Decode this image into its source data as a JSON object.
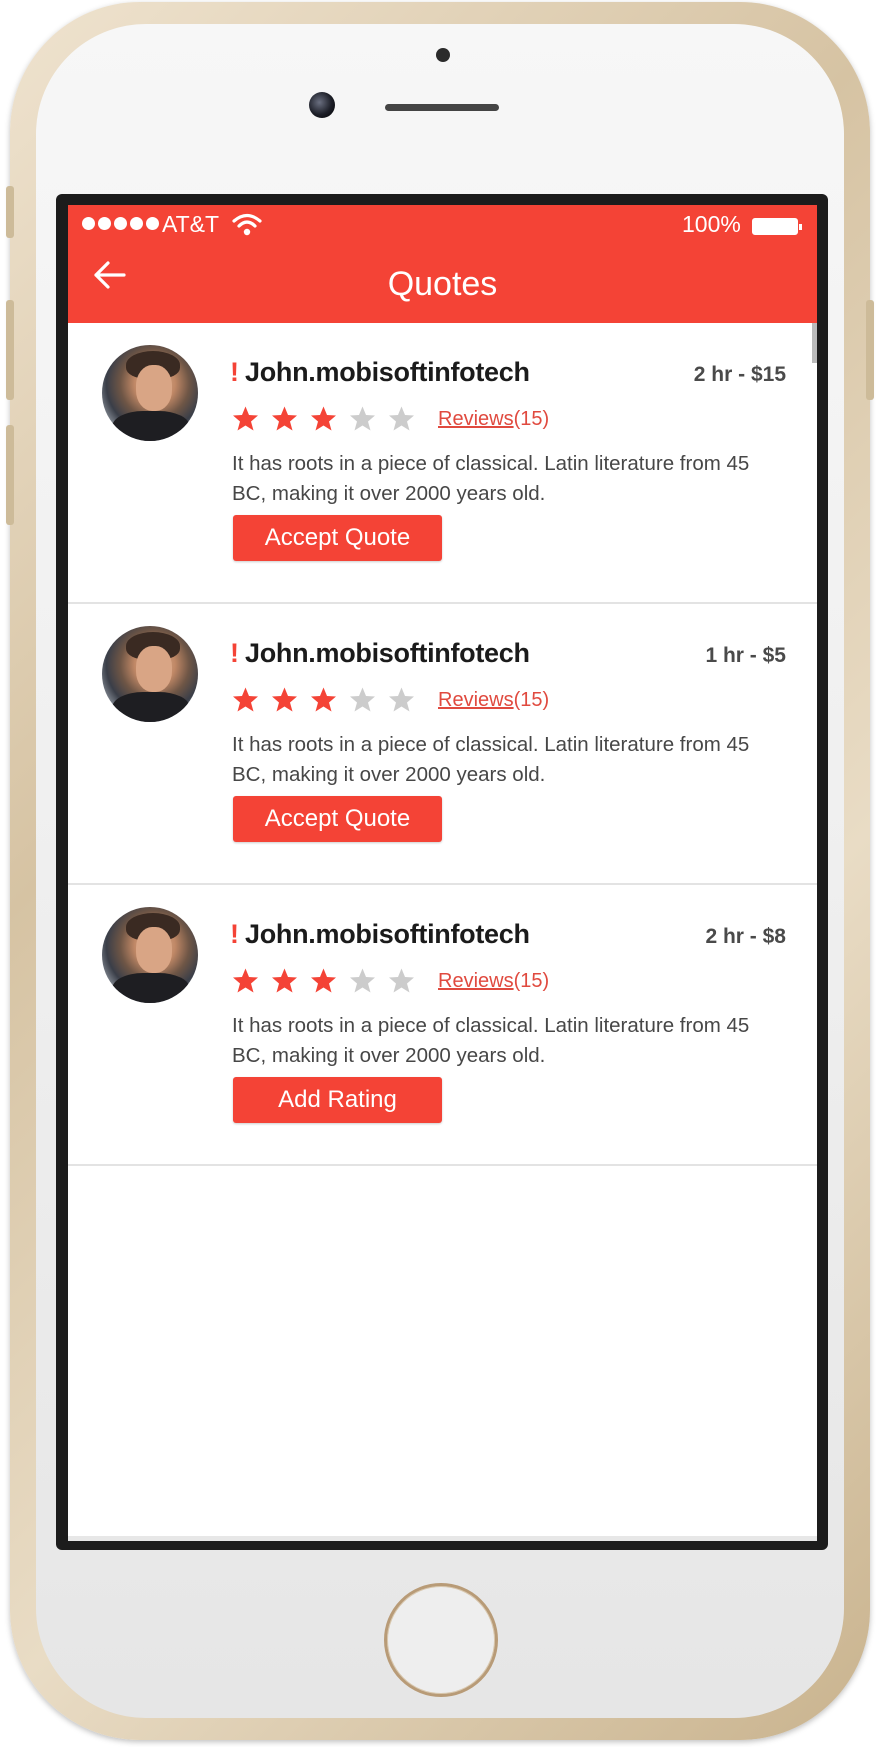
{
  "status_bar": {
    "carrier": "AT&T",
    "battery": "100%"
  },
  "header": {
    "title": "Quotes"
  },
  "quotes": [
    {
      "name": "John.mobisoftinfotech",
      "price": "2 hr - $15",
      "rating": 3,
      "rating_max": 5,
      "reviews_label": "Reviews",
      "reviews_count": "(15)",
      "description": "It has roots in a piece of classical.  Latin literature from 45 BC, making it over 2000 years old.",
      "button_label": "Accept Quote"
    },
    {
      "name": "John.mobisoftinfotech",
      "price": "1 hr - $5",
      "rating": 3,
      "rating_max": 5,
      "reviews_label": "Reviews",
      "reviews_count": "(15)",
      "description": "It has roots in a piece of classical.  Latin literature from 45 BC, making it over 2000 years old.",
      "button_label": "Accept Quote"
    },
    {
      "name": "John.mobisoftinfotech",
      "price": "2 hr - $8",
      "rating": 3,
      "rating_max": 5,
      "reviews_label": "Reviews",
      "reviews_count": "(15)",
      "description": "It has roots in a piece of classical.  Latin literature from 45 BC, making it over 2000 years old.",
      "button_label": "Add Rating"
    }
  ],
  "colors": {
    "accent": "#f44336",
    "star_filled": "#f44336",
    "star_empty": "#cccccc"
  }
}
